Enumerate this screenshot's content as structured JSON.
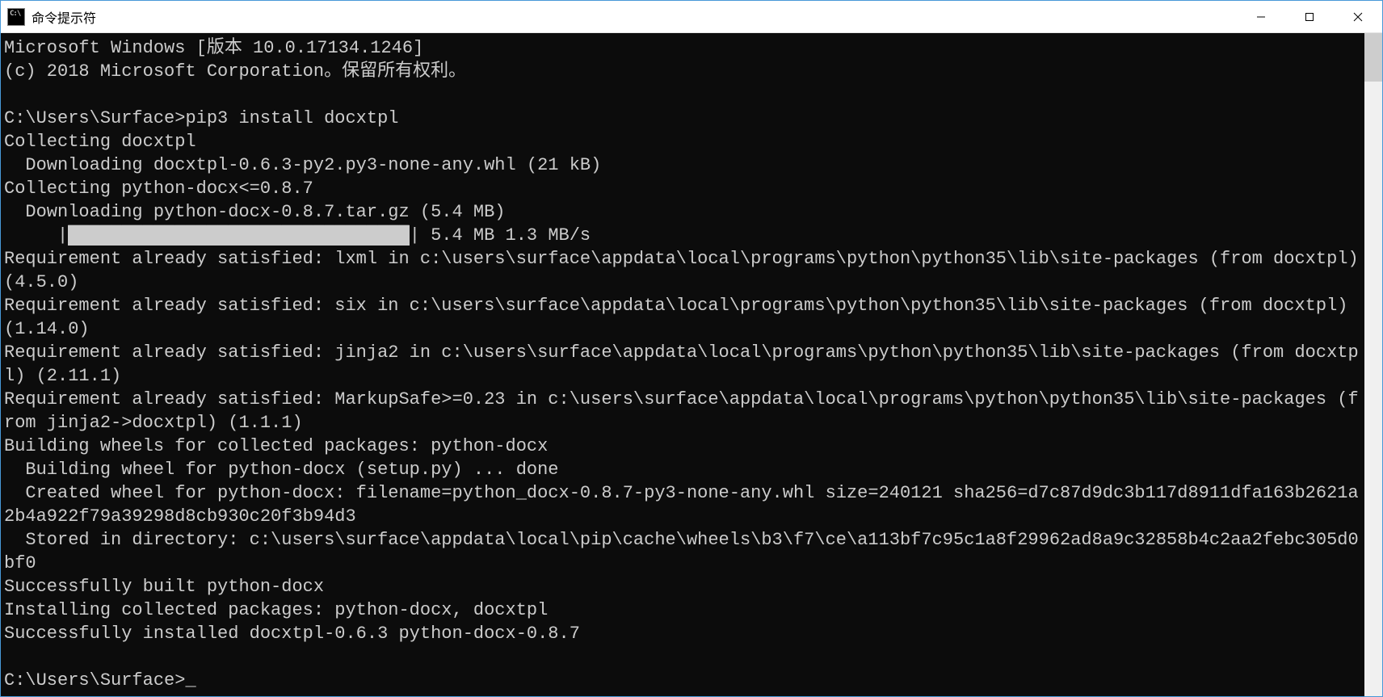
{
  "window": {
    "title": "命令提示符"
  },
  "terminal": {
    "line_version": "Microsoft Windows [版本 10.0.17134.1246]",
    "line_copyright": "(c) 2018 Microsoft Corporation。保留所有权利。",
    "blank": "",
    "prompt1_path": "C:\\Users\\Surface>",
    "prompt1_cmd": "pip3 install docxtpl",
    "line_collect1": "Collecting docxtpl",
    "line_download1": "  Downloading docxtpl-0.6.3-py2.py3-none-any.whl (21 kB)",
    "line_collect2": "Collecting python-docx<=0.8.7",
    "line_download2": "  Downloading python-docx-0.8.7.tar.gz (5.4 MB)",
    "progress_prefix": "     |",
    "progress_bar": "████████████████████████████████",
    "progress_suffix": "| 5.4 MB 1.3 MB/s",
    "line_req1": "Requirement already satisfied: lxml in c:\\users\\surface\\appdata\\local\\programs\\python\\python35\\lib\\site-packages (from docxtpl) (4.5.0)",
    "line_req2": "Requirement already satisfied: six in c:\\users\\surface\\appdata\\local\\programs\\python\\python35\\lib\\site-packages (from docxtpl) (1.14.0)",
    "line_req3": "Requirement already satisfied: jinja2 in c:\\users\\surface\\appdata\\local\\programs\\python\\python35\\lib\\site-packages (from docxtpl) (2.11.1)",
    "line_req4": "Requirement already satisfied: MarkupSafe>=0.23 in c:\\users\\surface\\appdata\\local\\programs\\python\\python35\\lib\\site-packages (from jinja2->docxtpl) (1.1.1)",
    "line_build1": "Building wheels for collected packages: python-docx",
    "line_build2": "  Building wheel for python-docx (setup.py) ... done",
    "line_created": "  Created wheel for python-docx: filename=python_docx-0.8.7-py3-none-any.whl size=240121 sha256=d7c87d9dc3b117d8911dfa163b2621a2b4a922f79a39298d8cb930c20f3b94d3",
    "line_stored": "  Stored in directory: c:\\users\\surface\\appdata\\local\\pip\\cache\\wheels\\b3\\f7\\ce\\a113bf7c95c1a8f29962ad8a9c32858b4c2aa2febc305d0bf0",
    "line_success_built": "Successfully built python-docx",
    "line_installing": "Installing collected packages: python-docx, docxtpl",
    "line_success_install": "Successfully installed docxtpl-0.6.3 python-docx-0.8.7",
    "prompt2_path": "C:\\Users\\Surface>",
    "cursor": "_"
  }
}
